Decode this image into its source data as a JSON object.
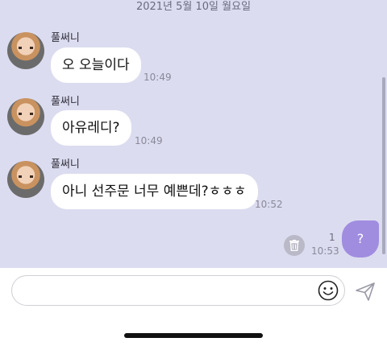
{
  "date_separator": "2021년 5월 10일 월요일",
  "messages": [
    {
      "sender": "풀써니",
      "text": "오 오늘이다",
      "time": "10:49"
    },
    {
      "sender": "풀써니",
      "text": "아유레디?",
      "time": "10:49"
    },
    {
      "sender": "풀써니",
      "text": "아니 선주문 너무 예쁜데?ㅎㅎㅎ",
      "time": "10:52"
    }
  ],
  "my_message": {
    "text": "?",
    "read_count": "1",
    "time": "10:53"
  },
  "input": {
    "placeholder": "",
    "value": ""
  },
  "icons": {
    "trash": "trash-icon",
    "emoji": "smiley-icon",
    "send": "send-icon"
  },
  "colors": {
    "chat_background": "#dcdcf0",
    "my_bubble": "#a08de0",
    "other_bubble": "#ffffff"
  }
}
